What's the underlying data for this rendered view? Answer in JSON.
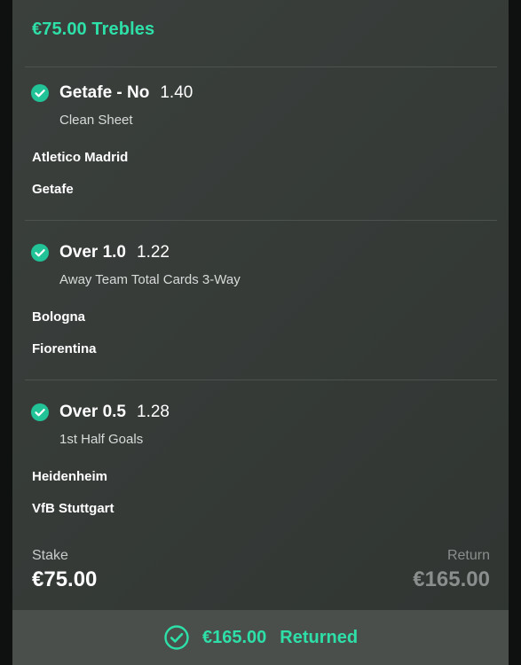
{
  "bet": {
    "title": "€75.00 Trebles"
  },
  "legs": [
    {
      "selection": "Getafe - No",
      "odds": "1.40",
      "market": "Clean Sheet",
      "team_home": "Atletico Madrid",
      "team_away": "Getafe",
      "status_icon": "check-circle-icon"
    },
    {
      "selection": "Over 1.0",
      "odds": "1.22",
      "market": "Away Team Total Cards 3-Way",
      "team_home": "Bologna",
      "team_away": "Fiorentina",
      "status_icon": "check-circle-icon"
    },
    {
      "selection": "Over 0.5",
      "odds": "1.28",
      "market": "1st Half Goals",
      "team_home": "Heidenheim",
      "team_away": "VfB Stuttgart",
      "status_icon": "check-circle-icon"
    }
  ],
  "summary": {
    "stake_label": "Stake",
    "stake_value": "€75.00",
    "return_label": "Return",
    "return_value": "€165.00"
  },
  "footer": {
    "amount": "€165.00",
    "status": "Returned",
    "icon": "check-circle-outline-icon"
  },
  "colors": {
    "accent": "#2ee0a8",
    "check_fill": "#21c397",
    "card_bg": "#383d3a",
    "footer_bg": "#4a4f4c",
    "muted": "#8a8e8c"
  }
}
